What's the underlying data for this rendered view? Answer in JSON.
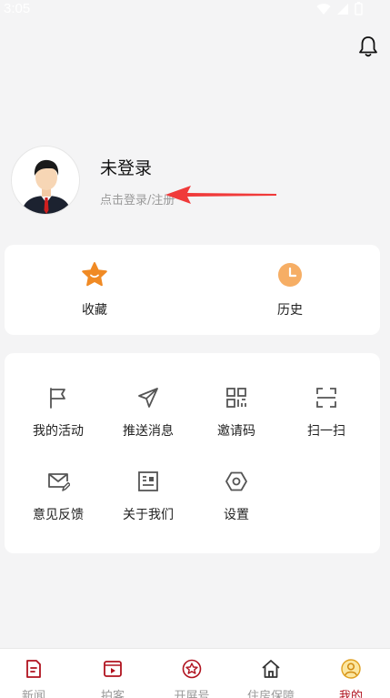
{
  "status_bar": {
    "time": "3:05"
  },
  "profile": {
    "name": "未登录",
    "login_link": "点击登录/注册"
  },
  "favorites": [
    {
      "label": "收藏",
      "icon": "star-icon"
    },
    {
      "label": "历史",
      "icon": "clock-icon"
    }
  ],
  "tools": [
    {
      "label": "我的活动",
      "icon": "flag-icon"
    },
    {
      "label": "推送消息",
      "icon": "send-icon"
    },
    {
      "label": "邀请码",
      "icon": "qr-code-icon"
    },
    {
      "label": "扫一扫",
      "icon": "scan-icon"
    },
    {
      "label": "意见反馈",
      "icon": "feedback-mail-icon"
    },
    {
      "label": "关于我们",
      "icon": "about-card-icon"
    },
    {
      "label": "设置",
      "icon": "settings-hexagon-icon"
    }
  ],
  "tabs": [
    {
      "label": "新闻",
      "icon": "news-icon",
      "active": false
    },
    {
      "label": "拍客",
      "icon": "video-icon",
      "active": false
    },
    {
      "label": "开屏号",
      "icon": "flower-badge-icon",
      "active": false
    },
    {
      "label": "住房保障",
      "icon": "house-icon",
      "active": false
    },
    {
      "label": "我的",
      "icon": "user-icon",
      "active": true
    }
  ],
  "colors": {
    "accent": "#b0121e",
    "star": "#f08a24",
    "clock": "#f5a04a",
    "icon_gray": "#555555",
    "background": "#f4f4f5"
  }
}
